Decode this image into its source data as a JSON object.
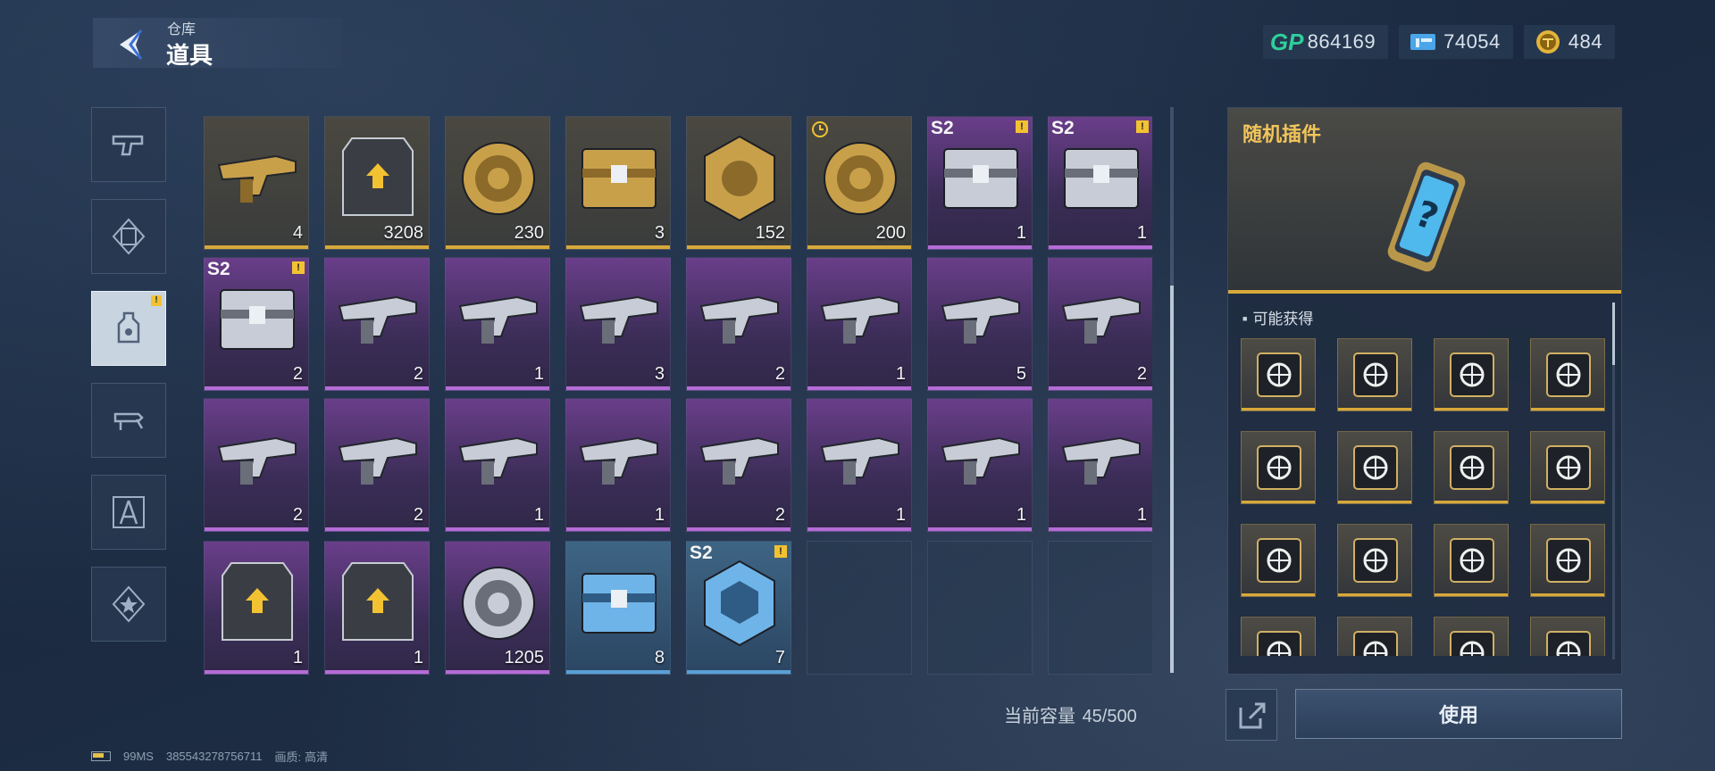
{
  "header": {
    "subtitle": "仓库",
    "title": "道具"
  },
  "currencies": [
    {
      "icon": "gp-icon",
      "label": "GP",
      "value": "864169",
      "color": "#2ecf9a"
    },
    {
      "icon": "ticket-icon",
      "label": "",
      "value": "74054",
      "color": "#4aa6e8"
    },
    {
      "icon": "coin-icon",
      "label": "",
      "value": "484",
      "color": "#e2b43a"
    }
  ],
  "tabs": [
    {
      "icon": "pistol-icon",
      "active": false
    },
    {
      "icon": "scroll-icon",
      "active": false
    },
    {
      "icon": "item-bag-icon",
      "active": true,
      "badge": "!"
    },
    {
      "icon": "gun-swap-icon",
      "active": false
    },
    {
      "icon": "compass-tool-icon",
      "active": false
    },
    {
      "icon": "star-badge-icon",
      "active": false
    }
  ],
  "items": [
    {
      "rarity": "gold",
      "art": "weapon-rifle",
      "qty": "4"
    },
    {
      "rarity": "gold",
      "art": "circuit-card",
      "qty": "3208"
    },
    {
      "rarity": "gold",
      "art": "gold-coin-cross",
      "qty": "230"
    },
    {
      "rarity": "gold",
      "art": "silver-case",
      "qty": "3"
    },
    {
      "rarity": "gold",
      "art": "gold-weapon-hex",
      "qty": "152"
    },
    {
      "rarity": "gold",
      "art": "pig-coin",
      "qty": "200",
      "timed": true
    },
    {
      "rarity": "purple",
      "art": "purple-crate",
      "qty": "1",
      "season": "S2",
      "warn": "!"
    },
    {
      "rarity": "purple",
      "art": "purple-crate",
      "qty": "1",
      "season": "S2",
      "warn": "!"
    },
    {
      "rarity": "purple",
      "art": "character-crate",
      "qty": "2",
      "season": "S2",
      "warn": "!"
    },
    {
      "rarity": "purple",
      "art": "weapon-smg",
      "qty": "2"
    },
    {
      "rarity": "purple",
      "art": "weapon-shotgun",
      "qty": "1"
    },
    {
      "rarity": "purple",
      "art": "weapon-camo-rifle",
      "qty": "3"
    },
    {
      "rarity": "purple",
      "art": "weapon-red-rifle",
      "qty": "2"
    },
    {
      "rarity": "purple",
      "art": "weapon-sniper",
      "qty": "1"
    },
    {
      "rarity": "purple",
      "art": "weapon-green-rifle",
      "qty": "5"
    },
    {
      "rarity": "purple",
      "art": "weapon-pistol",
      "qty": "2"
    },
    {
      "rarity": "purple",
      "art": "weapon-crossbow",
      "qty": "2"
    },
    {
      "rarity": "purple",
      "art": "weapon-ak",
      "qty": "2"
    },
    {
      "rarity": "purple",
      "art": "weapon-green-smg",
      "qty": "1"
    },
    {
      "rarity": "purple",
      "art": "weapon-tan-rifle",
      "qty": "1"
    },
    {
      "rarity": "purple",
      "art": "weapon-lmg",
      "qty": "2"
    },
    {
      "rarity": "purple",
      "art": "weapon-white-rifle",
      "qty": "1"
    },
    {
      "rarity": "purple",
      "art": "weapon-tan-smg",
      "qty": "1"
    },
    {
      "rarity": "purple",
      "art": "weapon-blue-launcher",
      "qty": "1"
    },
    {
      "rarity": "purple",
      "art": "upgrade-card-black",
      "qty": "1"
    },
    {
      "rarity": "purple",
      "art": "upgrade-card-dark",
      "qty": "1"
    },
    {
      "rarity": "purple",
      "art": "blue-disc",
      "qty": "1205"
    },
    {
      "rarity": "blue",
      "art": "blue-case",
      "qty": "8"
    },
    {
      "rarity": "blue",
      "art": "blue-cube",
      "qty": "7",
      "season": "S2",
      "warn": "!"
    },
    {
      "rarity": "empty"
    },
    {
      "rarity": "empty"
    },
    {
      "rarity": "empty"
    }
  ],
  "capacity": {
    "label": "当前容量",
    "value": "45/500"
  },
  "detail": {
    "title": "随机插件",
    "may_get": "可能获得",
    "rewards": [
      "rocket-mod-icon",
      "no-fire-mod-icon",
      "ammo-up-mod-icon",
      "target-person-mod-icon",
      "battery-mod-icon",
      "crosshair-mod-icon",
      "bullets-mod-icon",
      "gun-mod-icon",
      "diamond-burst-mod-icon",
      "mag-up-mod-icon",
      "shield-target-mod-icon",
      "dash-mod-icon",
      "locked-mod-icon",
      "locked-mod-icon",
      "locked-mod-icon",
      "locked-mod-icon"
    ]
  },
  "use_button": "使用",
  "footer": {
    "ping": "99MS",
    "id": "385543278756711",
    "quality_label": "画质:",
    "quality": "高清"
  }
}
